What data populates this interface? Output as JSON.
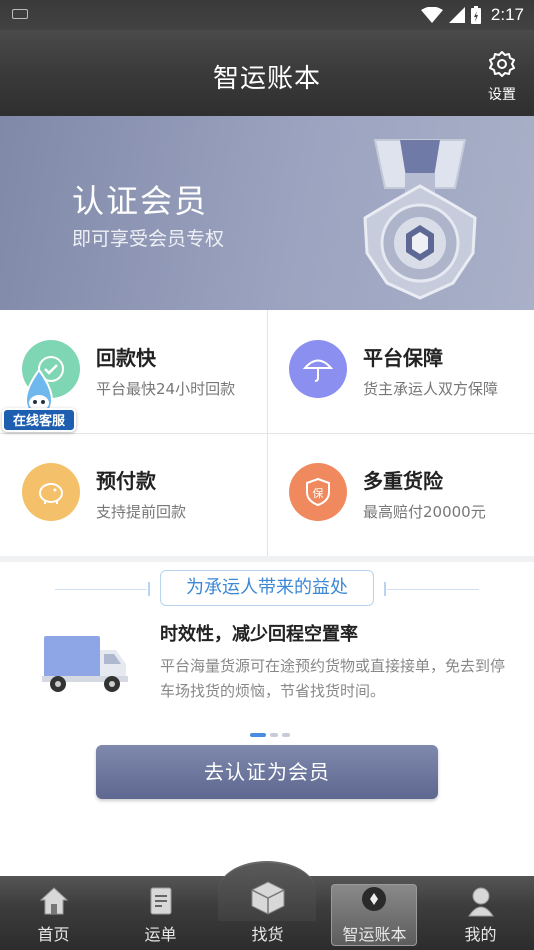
{
  "status_bar": {
    "time": "2:17"
  },
  "header": {
    "title": "智运账本",
    "settings_label": "设置"
  },
  "banner": {
    "heading": "认证会员",
    "subheading": "即可享受会员专权"
  },
  "features": [
    {
      "title": "回款快",
      "desc": "平台最快24小时回款",
      "color": "#7fd6b4",
      "icon": "clock-check-icon"
    },
    {
      "title": "平台保障",
      "desc": "货主承运人双方保障",
      "color": "#8a8ff0",
      "icon": "umbrella-icon"
    },
    {
      "title": "预付款",
      "desc": "支持提前回款",
      "color": "#f5c06a",
      "icon": "piggy-bank-icon"
    },
    {
      "title": "多重货险",
      "desc": "最高赔付20000元",
      "color": "#f08a5e",
      "icon": "insurance-shield-icon"
    }
  ],
  "support": {
    "label": "在线客服"
  },
  "benefits": {
    "heading": "为承运人带来的益处",
    "title": "时效性，减少回程空置率",
    "text": "平台海量货源可在途预约货物或直接接单，免去到停车场找货的烦恼，节省找货时间。",
    "page_index": 1,
    "page_count": 3
  },
  "cta": {
    "label": "去认证为会员"
  },
  "tabs": [
    {
      "label": "首页",
      "icon": "home-icon",
      "active": false
    },
    {
      "label": "运单",
      "icon": "waybill-icon",
      "active": false
    },
    {
      "label": "找货",
      "icon": "cargo-box-icon",
      "active": false
    },
    {
      "label": "智运账本",
      "icon": "ledger-icon",
      "active": true
    },
    {
      "label": "我的",
      "icon": "profile-icon",
      "active": false
    }
  ]
}
